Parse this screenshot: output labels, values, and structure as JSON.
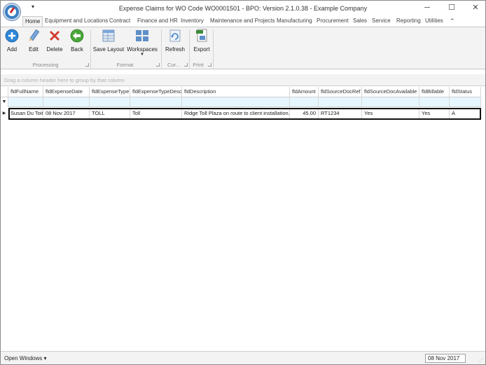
{
  "window": {
    "title": "Expense Claims for WO Code WO0001501 - BPO: Version 2.1.0.38 - Example Company",
    "qat_glyph": "▾",
    "minimize": "─",
    "maximize": "☐",
    "close": "✕"
  },
  "tabs": [
    {
      "label": "Home"
    },
    {
      "label": "Equipment and Locations"
    },
    {
      "label": "Contract"
    },
    {
      "label": "Finance and HR"
    },
    {
      "label": "Inventory"
    },
    {
      "label": "Maintenance and Projects"
    },
    {
      "label": "Manufacturing"
    },
    {
      "label": "Procurement"
    },
    {
      "label": "Sales"
    },
    {
      "label": "Service"
    },
    {
      "label": "Reporting"
    },
    {
      "label": "Utilities"
    }
  ],
  "ribbon": {
    "buttons": {
      "add": "Add",
      "edit": "Edit",
      "delete": "Delete",
      "back": "Back",
      "save_layout": "Save Layout",
      "workspaces": "Workspaces",
      "refresh": "Refresh",
      "export": "Export"
    },
    "groups": {
      "processing": "Processing",
      "format": "Format",
      "current": "Cur...",
      "print": "Print"
    }
  },
  "grid": {
    "group_panel_hint": "Drag a column header here to group by that column",
    "columns": [
      "fldFullName",
      "fldExpenseDate",
      "fldExpenseType",
      "fldExpenseTypeDesc",
      "fldDescription",
      "fldAmount",
      "fldSourceDocRef",
      "fldSourceDocAvailable",
      "fldBillable",
      "fldStatus"
    ],
    "rows": [
      {
        "fldFullName": "Susan Du Toit",
        "fldExpenseDate": "08 Nov 2017",
        "fldExpenseType": "TOLL",
        "fldExpenseTypeDesc": "Toll",
        "fldDescription": "Ridge Toll Plaza on route to client installation.",
        "fldAmount": "45.00",
        "fldSourceDocRef": "RT1234",
        "fldSourceDocAvailable": "Yes",
        "fldBillable": "Yes",
        "fldStatus": "A"
      }
    ]
  },
  "statusbar": {
    "open_windows": "Open Windows ▾",
    "date": "08 Nov 2017"
  },
  "colors": {
    "ribbon_bg": "#f3f3f3",
    "filter_row": "#e6f6ff",
    "add_icon": "#2e86d6",
    "delete_icon": "#d43a2f",
    "back_icon": "#4aa63a"
  }
}
